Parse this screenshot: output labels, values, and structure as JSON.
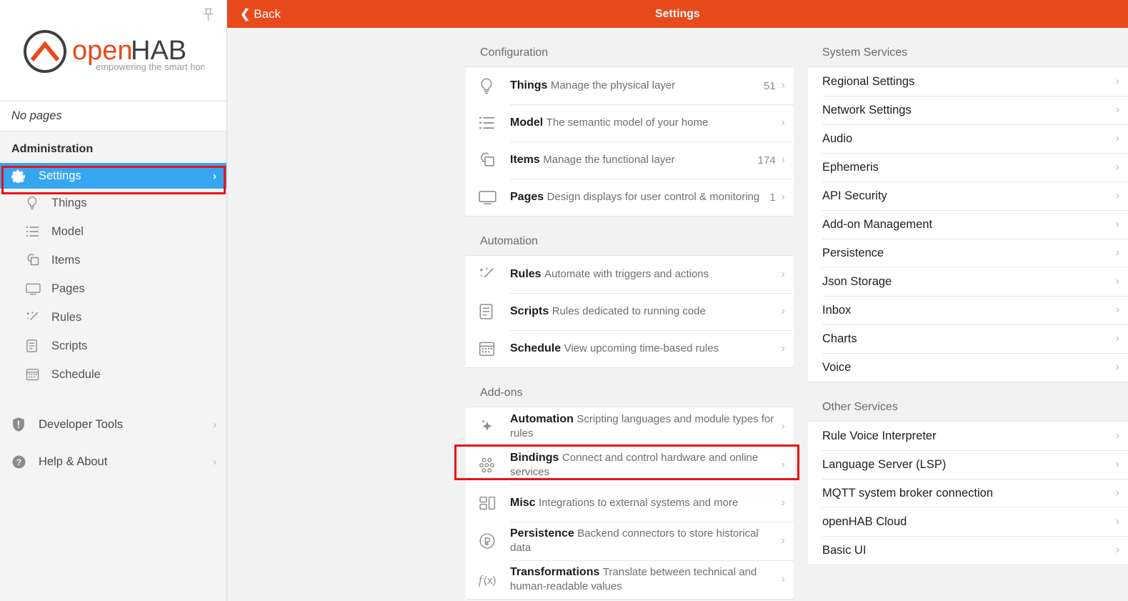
{
  "app": {
    "brand_name_part1": "open",
    "brand_name_part2": "HAB",
    "brand_tagline": "empowering the smart home",
    "accent_orange": "#e8491d",
    "accent_blue": "#36a6f2",
    "highlight_red": "#ee1111"
  },
  "sidebar": {
    "pin_icon": "pushpin-icon",
    "no_pages_label": "No pages",
    "administration_label": "Administration",
    "active_item": {
      "label": "Settings",
      "icon": "gear-icon",
      "chevron": "›"
    },
    "sub_items": [
      {
        "label": "Things",
        "icon": "lightbulb-icon"
      },
      {
        "label": "Model",
        "icon": "list-tree-icon"
      },
      {
        "label": "Items",
        "icon": "shapes-icon"
      },
      {
        "label": "Pages",
        "icon": "monitor-icon"
      },
      {
        "label": "Rules",
        "icon": "magic-wand-icon"
      },
      {
        "label": "Scripts",
        "icon": "document-icon"
      },
      {
        "label": "Schedule",
        "icon": "calendar-icon"
      }
    ],
    "bottom_items": [
      {
        "label": "Developer Tools",
        "icon": "shield-exclamation-icon",
        "chevron": "›"
      },
      {
        "label": "Help & About",
        "icon": "question-circle-icon",
        "chevron": "›"
      }
    ]
  },
  "topbar": {
    "back_label": "Back",
    "back_icon": "chevron-left-icon",
    "title": "Settings"
  },
  "sections": {
    "configuration": {
      "title": "Configuration",
      "items": [
        {
          "title": "Things",
          "subtitle": "Manage the physical layer",
          "count": "51",
          "icon": "lightbulb-icon"
        },
        {
          "title": "Model",
          "subtitle": "The semantic model of your home",
          "count": "",
          "icon": "list-tree-icon"
        },
        {
          "title": "Items",
          "subtitle": "Manage the functional layer",
          "count": "174",
          "icon": "shapes-icon"
        },
        {
          "title": "Pages",
          "subtitle": "Design displays for user control & monitoring",
          "count": "1",
          "icon": "monitor-icon"
        }
      ]
    },
    "automation": {
      "title": "Automation",
      "items": [
        {
          "title": "Rules",
          "subtitle": "Automate with triggers and actions",
          "count": "",
          "icon": "magic-wand-icon"
        },
        {
          "title": "Scripts",
          "subtitle": "Rules dedicated to running code",
          "count": "",
          "icon": "document-icon"
        },
        {
          "title": "Schedule",
          "subtitle": "View upcoming time-based rules",
          "count": "",
          "icon": "calendar-icon"
        }
      ]
    },
    "addons": {
      "title": "Add-ons",
      "items": [
        {
          "title": "Automation",
          "subtitle": "Scripting languages and module types for rules",
          "count": "",
          "icon": "sparkle-icon"
        },
        {
          "title": "Bindings",
          "subtitle": "Connect and control hardware and online services",
          "count": "",
          "icon": "dots-cluster-icon"
        },
        {
          "title": "Misc",
          "subtitle": "Integrations to external systems and more",
          "count": "",
          "icon": "blocks-icon"
        },
        {
          "title": "Persistence",
          "subtitle": "Backend connectors to store historical data",
          "count": "",
          "icon": "persistence-circle-icon"
        },
        {
          "title": "Transformations",
          "subtitle": "Translate between technical and human-readable values",
          "count": "",
          "icon": "fx-icon"
        }
      ]
    },
    "system_services": {
      "title": "System Services",
      "items": [
        {
          "title": "Regional Settings"
        },
        {
          "title": "Network Settings"
        },
        {
          "title": "Audio"
        },
        {
          "title": "Ephemeris"
        },
        {
          "title": "API Security"
        },
        {
          "title": "Add-on Management"
        },
        {
          "title": "Persistence"
        },
        {
          "title": "Json Storage"
        },
        {
          "title": "Inbox"
        },
        {
          "title": "Charts"
        },
        {
          "title": "Voice"
        }
      ]
    },
    "other_services": {
      "title": "Other Services",
      "items": [
        {
          "title": "Rule Voice Interpreter"
        },
        {
          "title": "Language Server (LSP)"
        },
        {
          "title": "MQTT system broker connection"
        },
        {
          "title": "openHAB Cloud"
        },
        {
          "title": "Basic UI"
        }
      ]
    }
  },
  "chevron": "›"
}
